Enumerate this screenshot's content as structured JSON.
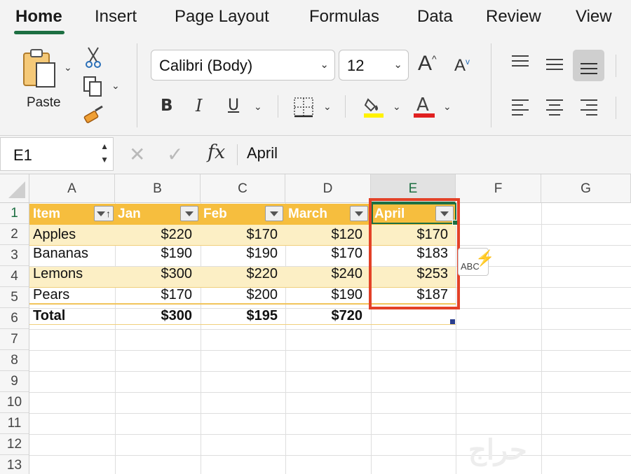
{
  "tabs": [
    "Home",
    "Insert",
    "Page Layout",
    "Formulas",
    "Data",
    "Review",
    "View"
  ],
  "clipboard": {
    "paste_label": "Paste"
  },
  "font": {
    "name": "Calibri (Body)",
    "size": "12"
  },
  "format_buttons": {
    "bold": "B",
    "italic": "I",
    "underline": "U"
  },
  "formula_bar": {
    "name_box": "E1",
    "fx": "fx",
    "content": "April"
  },
  "columns": [
    "A",
    "B",
    "C",
    "D",
    "E",
    "F",
    "G"
  ],
  "rows": [
    "1",
    "2",
    "3",
    "4",
    "5",
    "6",
    "7",
    "8",
    "9",
    "10",
    "11",
    "12",
    "13"
  ],
  "table": {
    "headers": [
      "Item",
      "Jan",
      "Feb",
      "March",
      "April"
    ],
    "data": [
      [
        "Apples",
        "$220",
        "$170",
        "$120",
        "$170"
      ],
      [
        "Bananas",
        "$190",
        "$190",
        "$170",
        "$183"
      ],
      [
        "Lemons",
        "$300",
        "$220",
        "$240",
        "$253"
      ],
      [
        "Pears",
        "$170",
        "$200",
        "$190",
        "$187"
      ]
    ],
    "total": [
      "Total",
      "$300",
      "$195",
      "$720",
      ""
    ]
  },
  "quick_analysis": {
    "label": "ABC"
  },
  "colors": {
    "accent": "#1d6f42",
    "table_header": "#f6be3e",
    "table_band": "#fcefc5",
    "highlight_box": "#e34127"
  }
}
